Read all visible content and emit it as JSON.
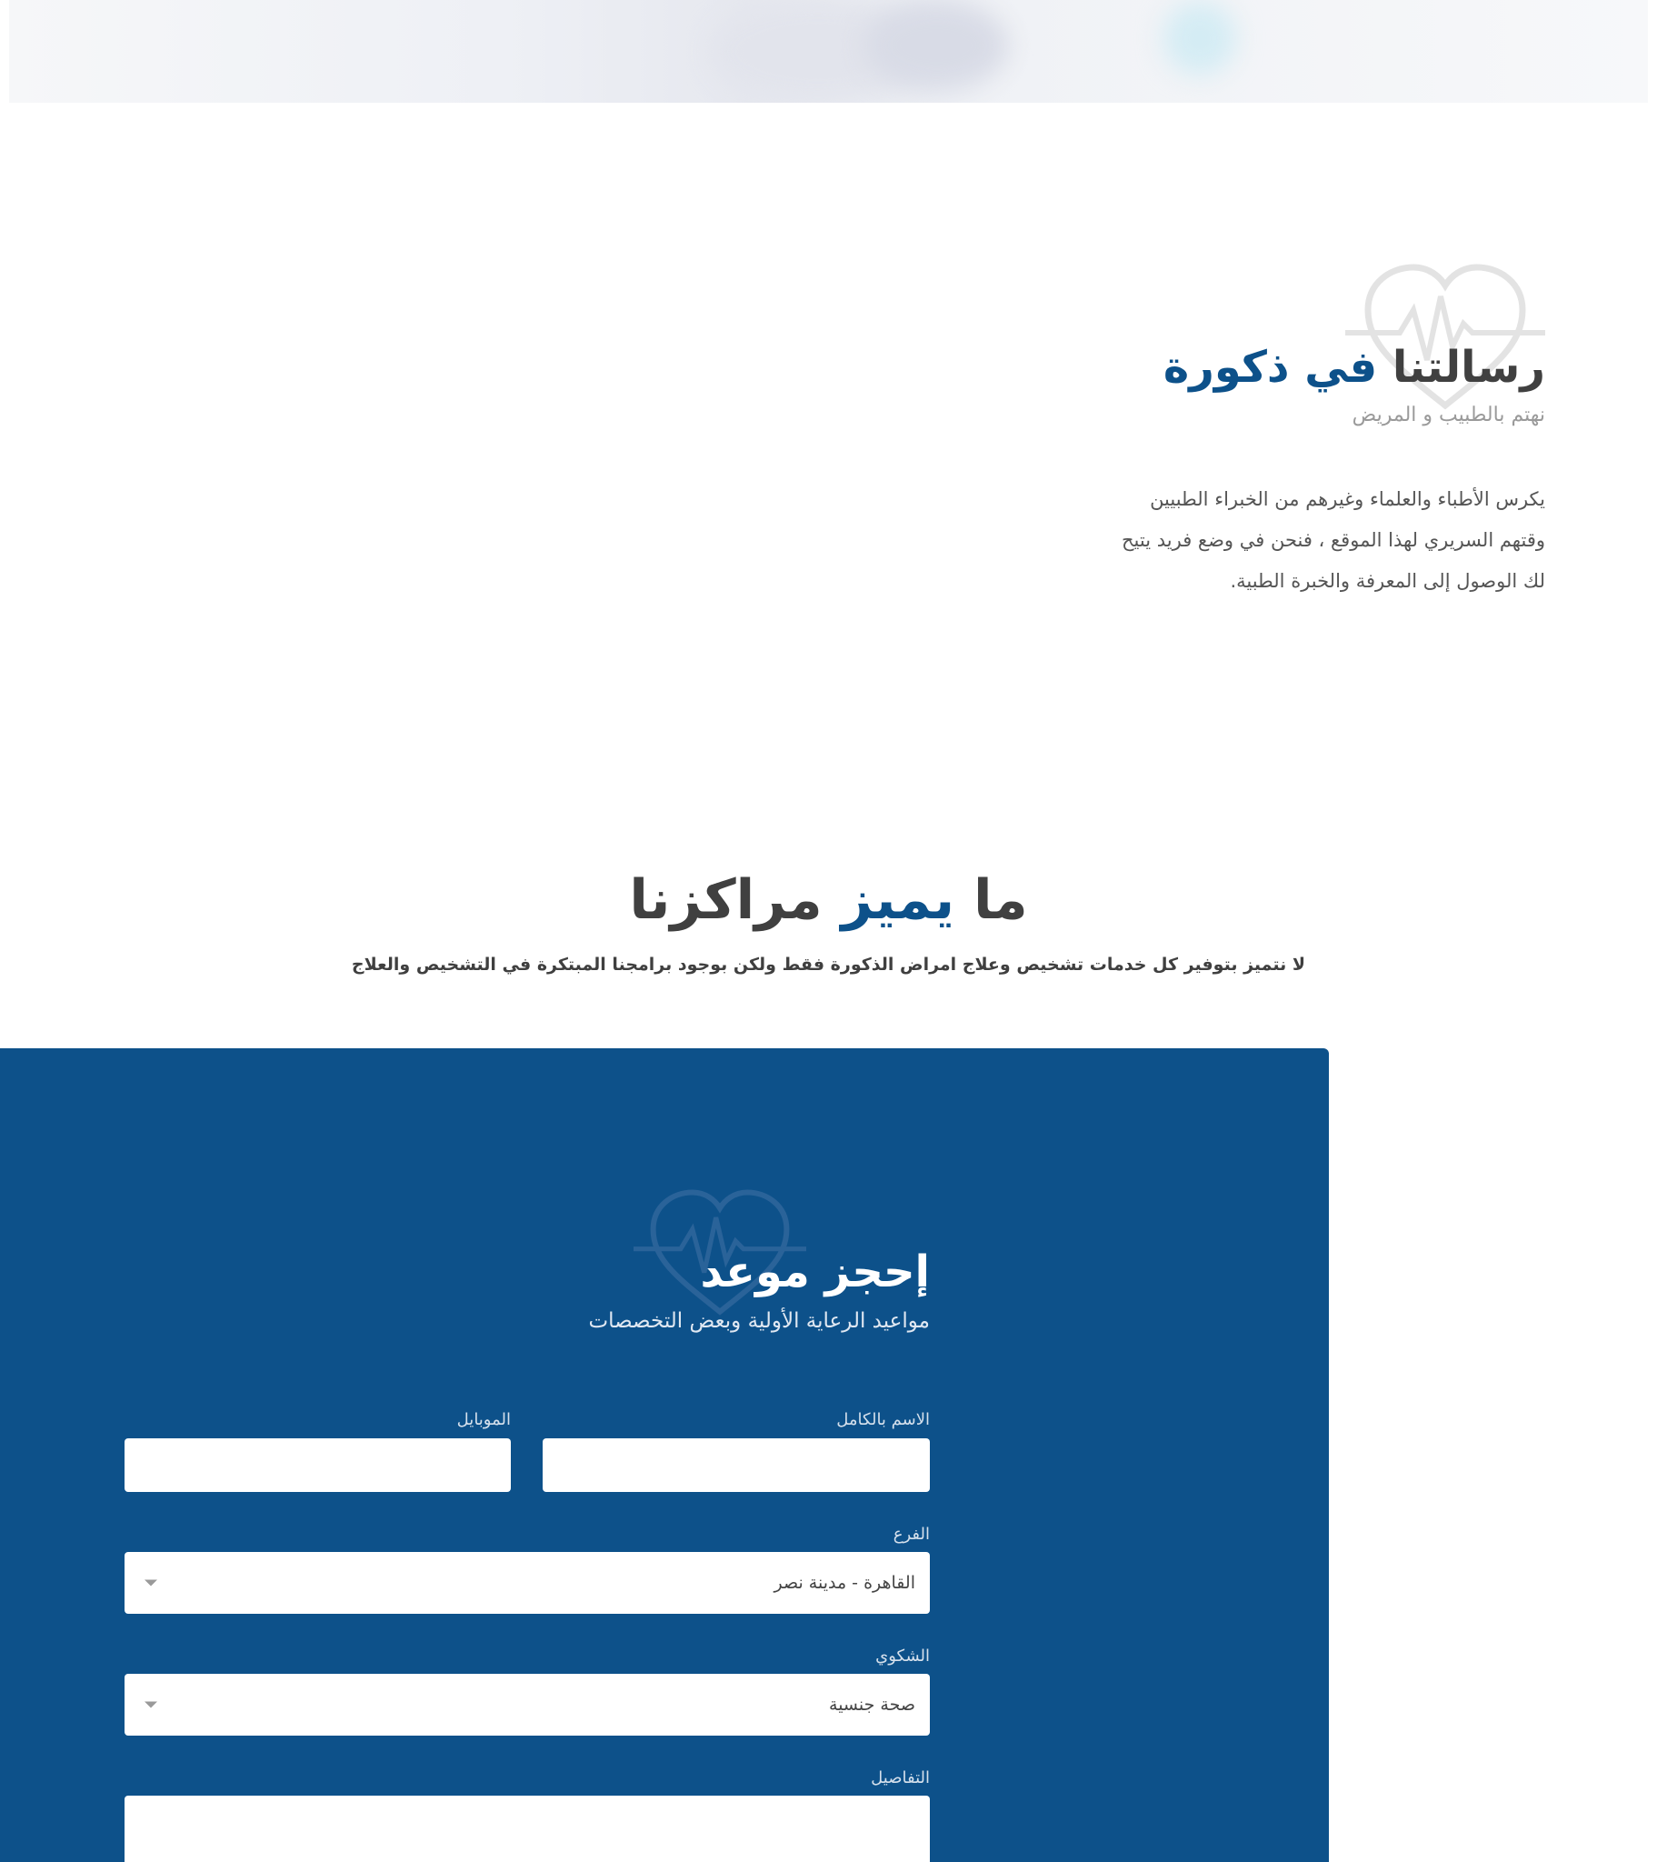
{
  "mission": {
    "title_main": "رسالتنا",
    "title_accent": "في ذكورة",
    "subtitle": "نهتم بالطبيب و المريض",
    "body_lines": [
      "يكرس الأطباء والعلماء وغيرهم من الخبراء الطبيين",
      "وقتهم السريري لهذا الموقع ، فنحن في وضع فريد يتيح",
      "لك الوصول إلى المعرفة والخبرة الطبية."
    ]
  },
  "features": {
    "title_word1": "ما",
    "title_accent": "يميز",
    "title_word3": "مراكزنا",
    "description": "لا نتميز بتوفير كل خدمات تشخيص وعلاج امراض الذكورة فقط ولكن بوجود برامجنا المبتكرة في التشخيص والعلاج"
  },
  "booking": {
    "title": "إحجز موعد",
    "subtitle": "مواعيد الرعاية الأولية وبعض التخصصات",
    "fullname_label": "الاسم بالكامل",
    "fullname_value": "",
    "mobile_label": "الموبايل",
    "mobile_value": "",
    "branch_label": "الفرع",
    "branch_selected": "القاهرة - مدينة نصر",
    "complaint_label": "الشكوي",
    "complaint_selected": "صحة جنسية",
    "details_label": "التفاصيل",
    "details_value": ""
  },
  "colors": {
    "brand_blue": "#0d518a",
    "heading_gray": "#404040"
  },
  "icons": {
    "watermark": "heart-pulse-icon",
    "select_arrow": "chevron-down-icon"
  }
}
